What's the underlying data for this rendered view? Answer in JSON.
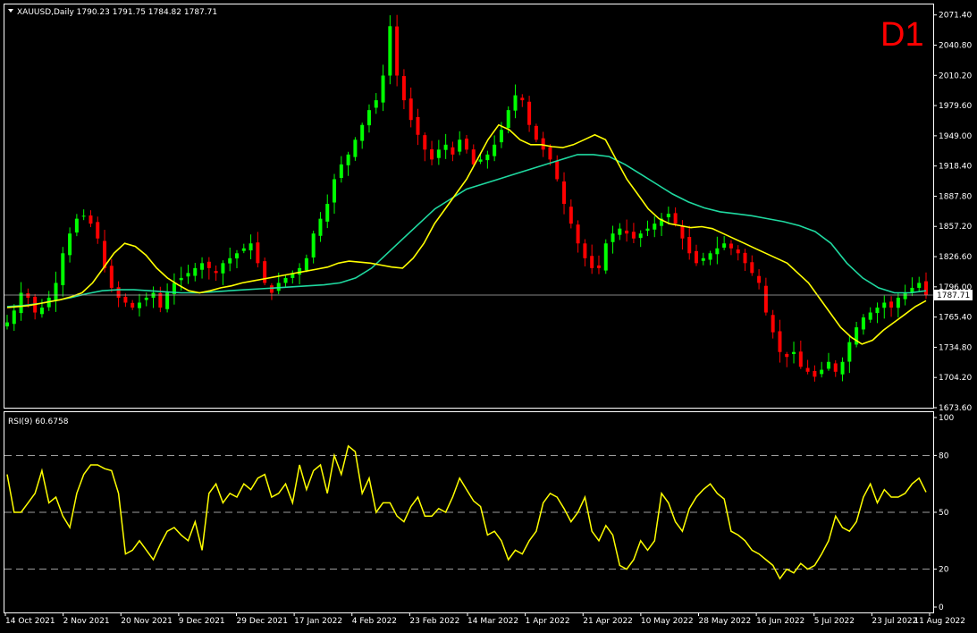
{
  "header": {
    "symbol_line": "XAUUSD,Daily  1790.23 1791.75 1784.82 1787.71",
    "timeframe": "D1",
    "current_price": "1787.71"
  },
  "rsi_header": "RSI(9) 60.6758",
  "colors": {
    "background": "#000000",
    "bull_candle": "#00ff00",
    "bear_candle": "#ff0000",
    "ma_fast": "#ffff00",
    "ma_slow": "#1fd9a0",
    "rsi_line": "#ffff00",
    "grid": "#ffffff",
    "timeframe_text": "#ff0000"
  },
  "chart_data": [
    {
      "type": "candlestick",
      "symbol": "XAUUSD",
      "timeframe": "Daily",
      "ylim": [
        1673.6,
        2082.0
      ],
      "y_ticks": [
        "2071.40",
        "2040.80",
        "2010.20",
        "1979.60",
        "1949.00",
        "1918.40",
        "1887.80",
        "1857.20",
        "1826.60",
        "1796.00",
        "1765.40",
        "1734.80",
        "1704.20",
        "1673.60"
      ],
      "x_ticks": [
        "14 Oct 2021",
        "2 Nov 2021",
        "20 Nov 2021",
        "9 Dec 2021",
        "29 Dec 2021",
        "17 Jan 2022",
        "4 Feb 2022",
        "23 Feb 2022",
        "14 Mar 2022",
        "1 Apr 2022",
        "21 Apr 2022",
        "10 May 2022",
        "28 May 2022",
        "16 Jun 2022",
        "5 Jul 2022",
        "23 Jul 2022",
        "11 Aug 2022"
      ],
      "close_path": [
        1760,
        1772,
        1790,
        1785,
        1770,
        1775,
        1785,
        1800,
        1830,
        1850,
        1865,
        1868,
        1860,
        1845,
        1815,
        1795,
        1785,
        1780,
        1775,
        1780,
        1785,
        1790,
        1775,
        1790,
        1800,
        1805,
        1810,
        1815,
        1820,
        1815,
        1810,
        1820,
        1825,
        1830,
        1835,
        1840,
        1820,
        1800,
        1790,
        1800,
        1805,
        1810,
        1815,
        1825,
        1850,
        1865,
        1880,
        1905,
        1920,
        1930,
        1945,
        1960,
        1975,
        1985,
        2010,
        2060,
        2010,
        1985,
        1965,
        1950,
        1935,
        1925,
        1935,
        1940,
        1930,
        1945,
        1935,
        1920,
        1925,
        1930,
        1940,
        1955,
        1975,
        1990,
        1985,
        1960,
        1945,
        1935,
        1925,
        1905,
        1880,
        1860,
        1840,
        1825,
        1815,
        1815,
        1840,
        1850,
        1855,
        1850,
        1845,
        1850,
        1855,
        1860,
        1865,
        1870,
        1860,
        1845,
        1830,
        1820,
        1825,
        1830,
        1835,
        1840,
        1835,
        1830,
        1820,
        1810,
        1800,
        1770,
        1750,
        1730,
        1725,
        1730,
        1715,
        1710,
        1705,
        1712,
        1720,
        1710,
        1720,
        1740,
        1755,
        1765,
        1770,
        1775,
        1780,
        1775,
        1785,
        1790,
        1795,
        1800,
        1787.71
      ],
      "series": [
        {
          "name": "",
          "role": "fast MA",
          "values": [
            1775,
            1776,
            1777,
            1779,
            1781,
            1783,
            1786,
            1790,
            1800,
            1815,
            1830,
            1840,
            1837,
            1828,
            1815,
            1805,
            1798,
            1792,
            1790,
            1792,
            1795,
            1797,
            1800,
            1802,
            1804,
            1806,
            1808,
            1810,
            1812,
            1814,
            1816,
            1820,
            1822,
            1821,
            1820,
            1818,
            1816,
            1815,
            1825,
            1840,
            1860,
            1875,
            1890,
            1905,
            1925,
            1945,
            1960,
            1955,
            1945,
            1940,
            1940,
            1938,
            1937,
            1940,
            1945,
            1950,
            1945,
            1925,
            1905,
            1890,
            1875,
            1865,
            1860,
            1858,
            1856,
            1857,
            1855,
            1850,
            1845,
            1840,
            1835,
            1830,
            1825,
            1820,
            1810,
            1800,
            1785,
            1770,
            1755,
            1745,
            1738,
            1742,
            1752,
            1760,
            1768,
            1776,
            1782
          ]
        },
        {
          "name": "",
          "role": "slow MA",
          "values": [
            1776,
            1777,
            1779,
            1782,
            1785,
            1789,
            1792,
            1793,
            1793,
            1792,
            1791,
            1790,
            1790,
            1791,
            1792,
            1793,
            1794,
            1795,
            1796,
            1797,
            1798,
            1800,
            1805,
            1815,
            1830,
            1845,
            1860,
            1875,
            1885,
            1895,
            1900,
            1905,
            1910,
            1915,
            1920,
            1925,
            1930,
            1930,
            1928,
            1920,
            1910,
            1900,
            1890,
            1882,
            1876,
            1872,
            1870,
            1868,
            1865,
            1862,
            1858,
            1852,
            1840,
            1820,
            1805,
            1795,
            1790,
            1790,
            1792
          ]
        }
      ]
    },
    {
      "type": "line",
      "title": "RSI(9) 60.6758",
      "ylim": [
        0,
        100
      ],
      "y_ticks": [
        "100",
        "80",
        "50",
        "20",
        "0"
      ],
      "levels": [
        80,
        50,
        20
      ],
      "series": [
        {
          "name": "RSI(9)",
          "values": [
            70,
            50,
            50,
            55,
            60,
            72,
            55,
            58,
            48,
            42,
            60,
            70,
            75,
            75,
            73,
            72,
            60,
            28,
            30,
            35,
            30,
            25,
            33,
            40,
            42,
            38,
            35,
            45,
            30,
            60,
            65,
            55,
            60,
            58,
            65,
            62,
            68,
            70,
            58,
            60,
            65,
            55,
            75,
            62,
            72,
            75,
            60,
            80,
            70,
            85,
            82,
            60,
            68,
            50,
            55,
            55,
            48,
            45,
            53,
            58,
            48,
            48,
            52,
            50,
            58,
            68,
            62,
            56,
            53,
            38,
            40,
            35,
            25,
            30,
            28,
            35,
            40,
            55,
            60,
            58,
            52,
            45,
            50,
            58,
            40,
            35,
            43,
            38,
            22,
            20,
            25,
            35,
            30,
            35,
            60,
            55,
            45,
            40,
            52,
            58,
            62,
            65,
            60,
            57,
            40,
            38,
            35,
            30,
            28,
            25,
            22,
            15,
            20,
            18,
            23,
            20,
            22,
            28,
            35,
            48,
            42,
            40,
            45,
            58,
            65,
            55,
            62,
            58,
            58,
            60,
            65,
            68,
            60.6758
          ]
        }
      ]
    }
  ],
  "x_axis": [
    "14 Oct 2021",
    "2 Nov 2021",
    "20 Nov 2021",
    "9 Dec 2021",
    "29 Dec 2021",
    "17 Jan 2022",
    "4 Feb 2022",
    "23 Feb 2022",
    "14 Mar 2022",
    "1 Apr 2022",
    "21 Apr 2022",
    "10 May 2022",
    "28 May 2022",
    "16 Jun 2022",
    "5 Jul 2022",
    "23 Jul 2022",
    "11 Aug 2022"
  ],
  "price_axis": [
    "2071.40",
    "2040.80",
    "2010.20",
    "1979.60",
    "1949.00",
    "1918.40",
    "1887.80",
    "1857.20",
    "1826.60",
    "1796.00",
    "1765.40",
    "1734.80",
    "1704.20",
    "1673.60"
  ],
  "rsi_axis": [
    "100",
    "80",
    "50",
    "20",
    "0"
  ]
}
